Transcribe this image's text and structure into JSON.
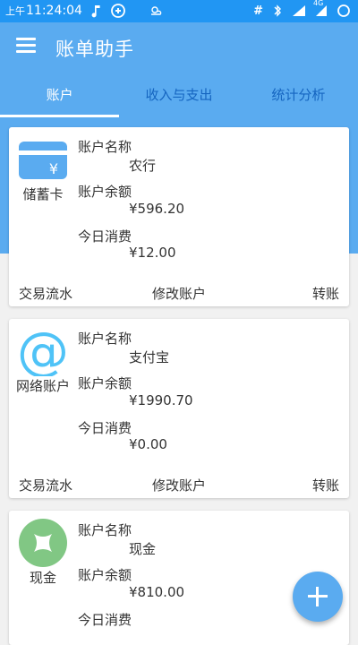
{
  "status_bar": {
    "ampm": "上午",
    "time": "11:24:04",
    "icons_left": [
      "music-icon",
      "sync-icon",
      "weather-icon"
    ],
    "network": "4G",
    "icons_right": [
      "hash-icon",
      "bluetooth-icon",
      "wifi-icon",
      "signal-icon",
      "battery-icon"
    ]
  },
  "app_bar": {
    "title": "账单助手",
    "menu_icon": "menu-icon"
  },
  "tabs": [
    {
      "label": "账户",
      "active": true
    },
    {
      "label": "收入与支出",
      "active": false
    },
    {
      "label": "统计分析",
      "active": false
    }
  ],
  "field_labels": {
    "name": "账户名称",
    "balance": "账户余额",
    "today": "今日消费"
  },
  "actions": {
    "transactions": "交易流水",
    "edit": "修改账户",
    "transfer": "转账"
  },
  "accounts": [
    {
      "type": "储蓄卡",
      "icon": "card-icon",
      "name": "农行",
      "balance": "¥596.20",
      "today": "¥12.00"
    },
    {
      "type": "网络账户",
      "icon": "at-icon",
      "name": "支付宝",
      "balance": "¥1990.70",
      "today": "¥0.00"
    },
    {
      "type": "现金",
      "icon": "cash-icon",
      "name": "现金",
      "balance": "¥810.00",
      "today": ""
    }
  ],
  "fab": {
    "icon": "add-icon"
  },
  "colors": {
    "primary": "#5aabf0",
    "status_bar": "#2196f3",
    "cash_green": "#81c784"
  }
}
